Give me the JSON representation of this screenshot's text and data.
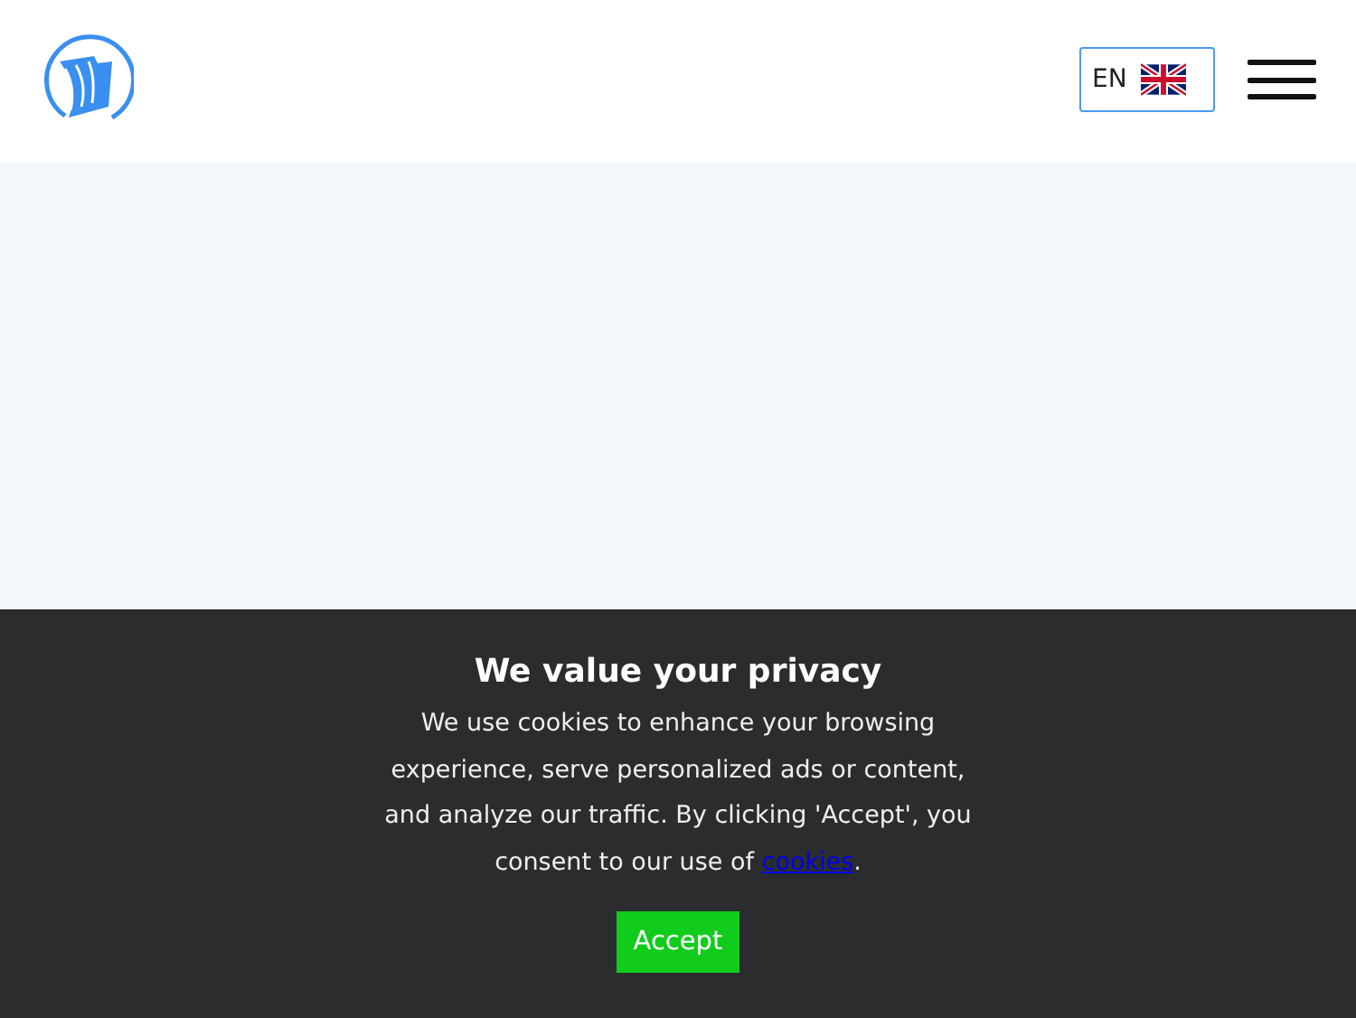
{
  "header": {
    "language": "EN"
  },
  "cookie_banner": {
    "title": "We value your privacy",
    "body": "We use cookies to enhance your browsing experience, serve personalized ads or content, and analyze our traffic. By clicking 'Accept', you consent to our use of ",
    "link": "cookies",
    "body_end": ".",
    "button": "Accept"
  }
}
